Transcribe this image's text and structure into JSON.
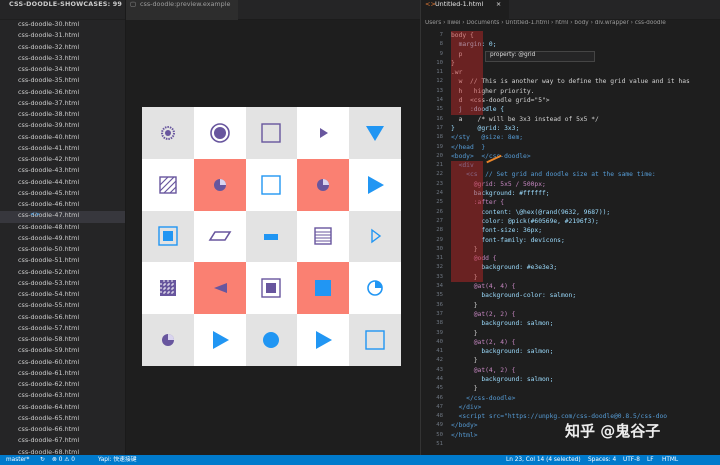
{
  "sidebar": {
    "title": "CSS-DOODLE-SHOWCASES: 99",
    "files": [
      "css-doodle-30.html",
      "css-doodle-31.html",
      "css-doodle-32.html",
      "css-doodle-33.html",
      "css-doodle-34.html",
      "css-doodle-35.html",
      "css-doodle-36.html",
      "css-doodle-37.html",
      "css-doodle-38.html",
      "css-doodle-39.html",
      "css-doodle-40.html",
      "css-doodle-41.html",
      "css-doodle-42.html",
      "css-doodle-43.html",
      "css-doodle-44.html",
      "css-doodle-45.html",
      "css-doodle-46.html",
      "css-doodle-47.html",
      "css-doodle-48.html",
      "css-doodle-49.html",
      "css-doodle-50.html",
      "css-doodle-51.html",
      "css-doodle-52.html",
      "css-doodle-53.html",
      "css-doodle-54.html",
      "css-doodle-55.html",
      "css-doodle-56.html",
      "css-doodle-57.html",
      "css-doodle-58.html",
      "css-doodle-59.html",
      "css-doodle-60.html",
      "css-doodle-61.html",
      "css-doodle-62.html",
      "css-doodle-63.html",
      "css-doodle-64.html",
      "css-doodle-65.html",
      "css-doodle-66.html",
      "css-doodle-67.html",
      "css-doodle-68.html"
    ],
    "active_index": 17,
    "active_badge": "<>"
  },
  "preview": {
    "tab_label": "css-doodle:preview.example",
    "colors": {
      "salmon": "#fa8072",
      "odd": "#e3e3e3",
      "white": "#ffffff",
      "purple": "#68569e",
      "blue": "#2196f3"
    },
    "cells": [
      {
        "bg": "odd",
        "icon": "dotted-circle",
        "color": "purple"
      },
      {
        "bg": "white",
        "icon": "ring-circle",
        "color": "purple"
      },
      {
        "bg": "odd",
        "icon": "outline-square",
        "color": "purple"
      },
      {
        "bg": "white",
        "icon": "small-right-triangle",
        "color": "purple"
      },
      {
        "bg": "odd",
        "icon": "down-triangle",
        "color": "blue"
      },
      {
        "bg": "white",
        "icon": "hatched-square",
        "color": "purple"
      },
      {
        "bg": "salmon",
        "icon": "quarter-circle",
        "color": "purple"
      },
      {
        "bg": "white",
        "icon": "outline-square",
        "color": "blue"
      },
      {
        "bg": "salmon",
        "icon": "quarter-circle",
        "color": "purple"
      },
      {
        "bg": "white",
        "icon": "right-triangle",
        "color": "blue"
      },
      {
        "bg": "odd",
        "icon": "boxed-square",
        "color": "blue"
      },
      {
        "bg": "white",
        "icon": "parallelogram",
        "color": "purple"
      },
      {
        "bg": "odd",
        "icon": "bar",
        "color": "blue"
      },
      {
        "bg": "white",
        "icon": "lined-square",
        "color": "purple"
      },
      {
        "bg": "odd",
        "icon": "outline-right-triangle",
        "color": "blue"
      },
      {
        "bg": "white",
        "icon": "checker-square",
        "color": "purple"
      },
      {
        "bg": "salmon",
        "icon": "left-triangle",
        "color": "purple"
      },
      {
        "bg": "white",
        "icon": "boxed-square",
        "color": "purple"
      },
      {
        "bg": "salmon",
        "icon": "square",
        "color": "blue"
      },
      {
        "bg": "white",
        "icon": "quarter-circle-outline",
        "color": "blue"
      },
      {
        "bg": "odd",
        "icon": "quarter-circle",
        "color": "purple"
      },
      {
        "bg": "white",
        "icon": "right-triangle",
        "color": "blue"
      },
      {
        "bg": "odd",
        "icon": "circle",
        "color": "blue"
      },
      {
        "bg": "white",
        "icon": "right-triangle",
        "color": "blue"
      },
      {
        "bg": "odd",
        "icon": "outline-square",
        "color": "blue"
      }
    ]
  },
  "editor": {
    "tab_label": "Untitled-1.html",
    "breadcrumb": "Users › liwei › Documents › Untitled-1.html › html › body › div.wrapper › css-doodle",
    "tooltip": "property: @grid",
    "line_start": 7,
    "lines": [
      "body {",
      "  margin: 0;",
      "  p",
      "}",
      ".wr",
      "  w  // This is another way to define the grid value and it has",
      "  h   higher priority.",
      "  d  <css-doodle grid=\"5\">",
      "  j  :doodle {",
      "  a    /* will be 3x3 instead of 5x5 */",
      "}      @grid: 3x3;",
      "</sty   @size: 8em;",
      "</head  }",
      "<body>  </css-doodle>",
      "  <div",
      "    <cs  // Set grid and doodle size at the same time:",
      "      @grid: 5x5 / 500px;",
      "      background: #ffffff;",
      "      :after {",
      "        content: \\@hex(@rand(9632, 9687));",
      "        color: @pick(#60569e, #2196f3);",
      "        font-size: 36px;",
      "        font-family: devicons;",
      "      }",
      "      @odd {",
      "        background: #e3e3e3;",
      "      }",
      "      @at(4, 4) {",
      "        background-color: salmon;",
      "      }",
      "      @at(2, 2) {",
      "        background: salmon;",
      "      }",
      "      @at(2, 4) {",
      "        background: salmon;",
      "      }",
      "      @at(4, 2) {",
      "        background: salmon;",
      "      }",
      "    </css-doodle>",
      "  </div>",
      "  <script src=\"https://unpkg.com/css-doodle@0.8.5/css-doo",
      "</body>",
      "</html>",
      ""
    ]
  },
  "statusbar": {
    "branch": "master*",
    "sync": "↻",
    "errors": "⊗ 0 ⚠ 0",
    "yapi": "Yapi: 快速接键",
    "position": "Ln 23, Col 14 (4 selected)",
    "spaces": "Spaces: 4",
    "encoding": "UTF-8",
    "eol": "LF",
    "language": "HTML"
  },
  "watermark": "知乎 @鬼谷子"
}
